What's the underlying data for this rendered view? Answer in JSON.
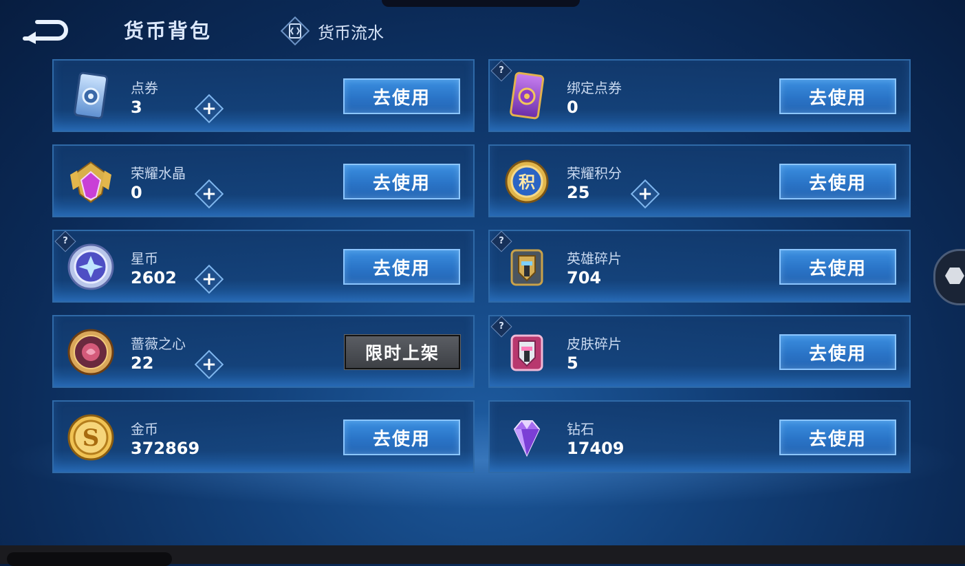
{
  "header": {
    "title": "货币背包",
    "flow_tab_label": "货币流水"
  },
  "action_labels": {
    "use": "去使用",
    "limited": "限时上架"
  },
  "currencies": [
    {
      "name": "点券",
      "value": "3",
      "icon": "coupon-card-icon",
      "has_plus": true,
      "has_help": false,
      "action": "use"
    },
    {
      "name": "绑定点券",
      "value": "0",
      "icon": "bound-coupon-card-icon",
      "has_plus": false,
      "has_help": true,
      "action": "use"
    },
    {
      "name": "荣耀水晶",
      "value": "0",
      "icon": "glory-crystal-icon",
      "has_plus": true,
      "has_help": false,
      "action": "use"
    },
    {
      "name": "荣耀积分",
      "value": "25",
      "icon": "glory-points-icon",
      "has_plus": true,
      "has_help": false,
      "action": "use"
    },
    {
      "name": "星币",
      "value": "2602",
      "icon": "star-coin-icon",
      "has_plus": true,
      "has_help": true,
      "action": "use"
    },
    {
      "name": "英雄碎片",
      "value": "704",
      "icon": "hero-fragment-icon",
      "has_plus": false,
      "has_help": true,
      "action": "use"
    },
    {
      "name": "蔷薇之心",
      "value": "22",
      "icon": "rose-heart-icon",
      "has_plus": true,
      "has_help": false,
      "action": "limited"
    },
    {
      "name": "皮肤碎片",
      "value": "5",
      "icon": "skin-fragment-icon",
      "has_plus": false,
      "has_help": true,
      "action": "use"
    },
    {
      "name": "金币",
      "value": "372869",
      "icon": "gold-coin-icon",
      "has_plus": false,
      "has_help": false,
      "action": "use"
    },
    {
      "name": "钻石",
      "value": "17409",
      "icon": "diamond-icon",
      "has_plus": false,
      "has_help": false,
      "action": "use"
    }
  ],
  "colors": {
    "card_border": "#2f6aa8",
    "use_button": "#2a74c7",
    "limited_button": "#4a4d52",
    "background": "#0b2a57"
  }
}
